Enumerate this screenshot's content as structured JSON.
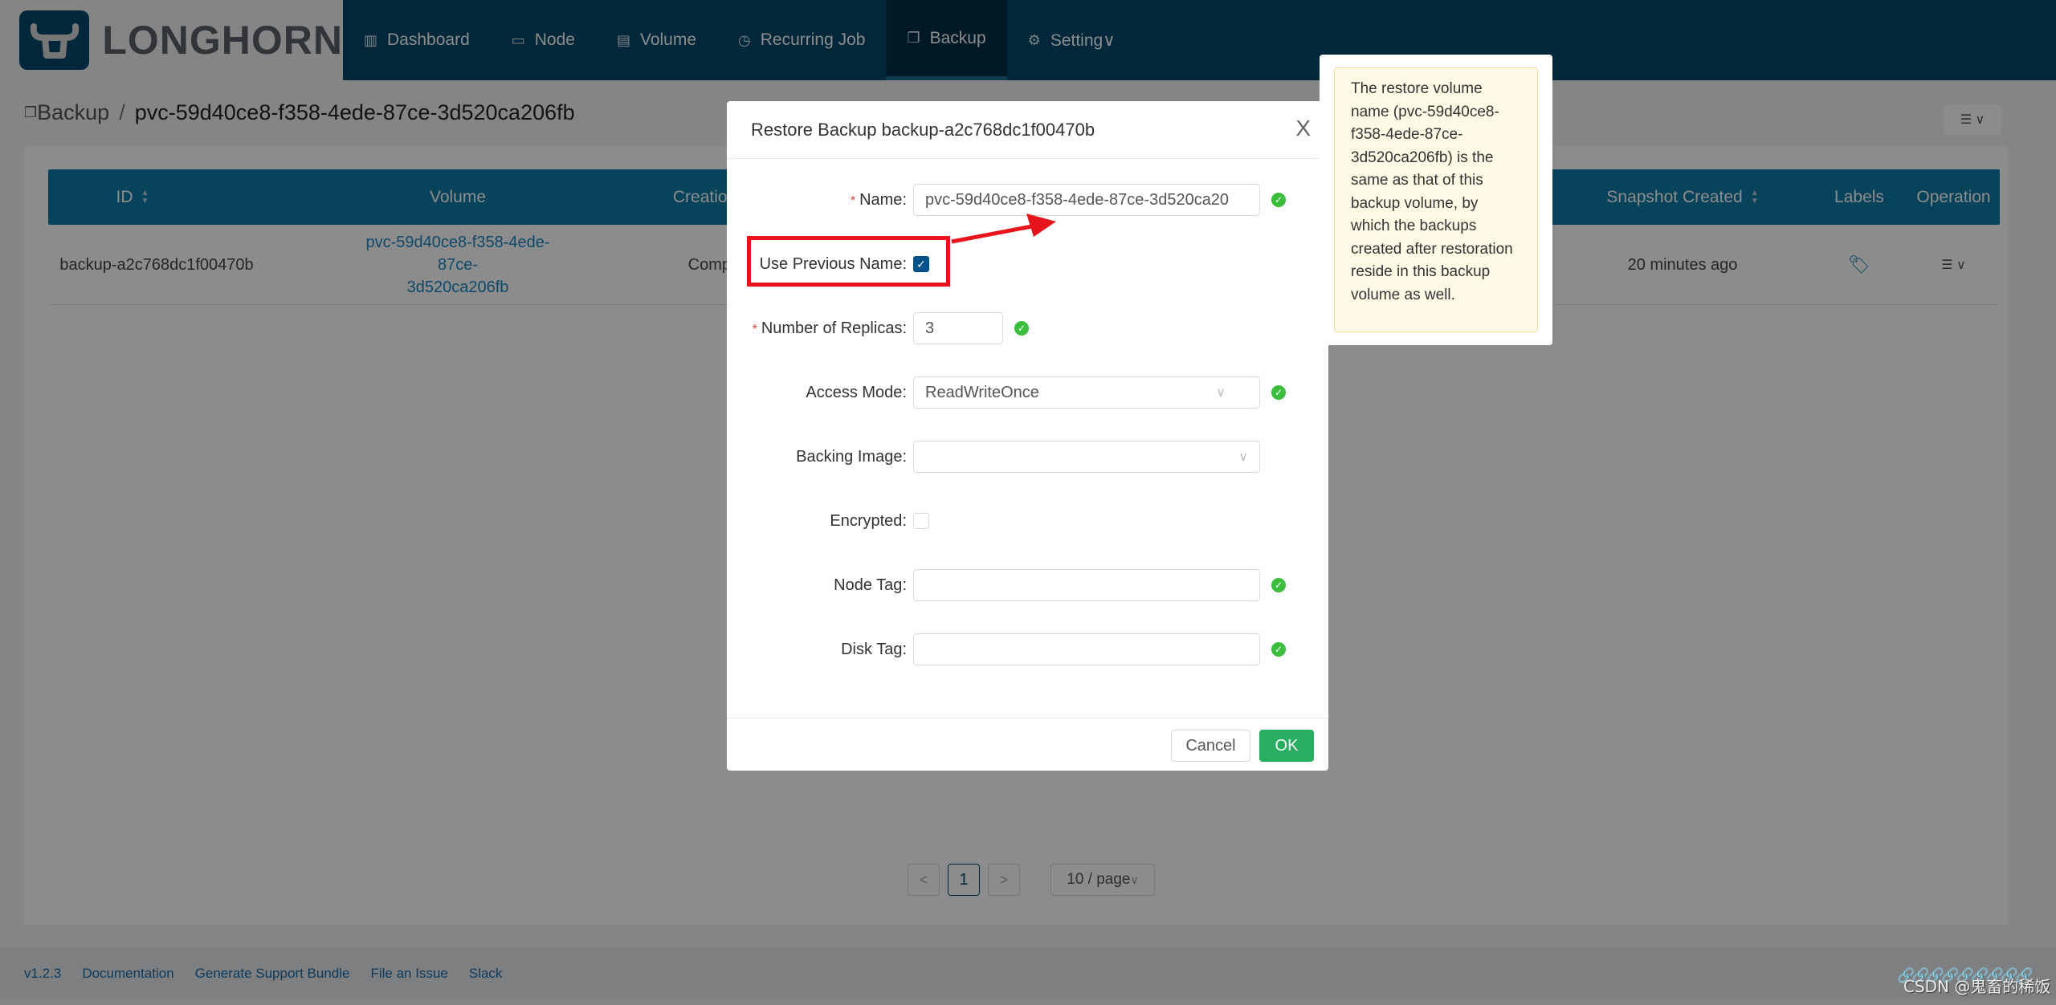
{
  "app": {
    "logo_text": "LONGHORN"
  },
  "nav": {
    "items": [
      {
        "label": "Dashboard",
        "icon": "bar-chart-icon"
      },
      {
        "label": "Node",
        "icon": "laptop-icon"
      },
      {
        "label": "Volume",
        "icon": "database-icon"
      },
      {
        "label": "Recurring Job",
        "icon": "clock-icon"
      },
      {
        "label": "Backup",
        "icon": "copy-icon",
        "active": true
      },
      {
        "label": "Setting∨",
        "icon": "gear-icon"
      }
    ]
  },
  "breadcrumb": {
    "root": "Backup",
    "separator": "/",
    "current": "pvc-59d40ce8-f358-4ede-87ce-3d520ca206fb"
  },
  "table": {
    "columns": [
      "ID",
      "Volume",
      "Creation State",
      "Snapshot Created",
      "Labels",
      "Operation"
    ],
    "rows": [
      {
        "id": "backup-a2c768dc1f00470b",
        "volume_line1": "pvc-59d40ce8-f358-4ede-87ce-",
        "volume_line2": "3d520ca206fb",
        "creation_state": "Completed",
        "snapshot_created": "20 minutes ago"
      }
    ]
  },
  "pagination": {
    "prev": "<",
    "current_page": "1",
    "next": ">",
    "page_size": "10 / page"
  },
  "footer": {
    "links": [
      "v1.2.3",
      "Documentation",
      "Generate Support Bundle",
      "File an Issue",
      "Slack"
    ]
  },
  "modal": {
    "title": "Restore Backup backup-a2c768dc1f00470b",
    "close": "X",
    "fields": {
      "name": {
        "label": "Name",
        "value": "pvc-59d40ce8-f358-4ede-87ce-3d520ca20",
        "required": true
      },
      "use_previous_name": {
        "label": "Use Previous Name",
        "checked": true
      },
      "replicas": {
        "label": "Number of Replicas",
        "value": "3",
        "required": true
      },
      "access_mode": {
        "label": "Access Mode",
        "value": "ReadWriteOnce"
      },
      "backing_image": {
        "label": "Backing Image",
        "value": ""
      },
      "encrypted": {
        "label": "Encrypted",
        "checked": false
      },
      "node_tag": {
        "label": "Node Tag",
        "value": ""
      },
      "disk_tag": {
        "label": "Disk Tag",
        "value": ""
      }
    },
    "cancel": "Cancel",
    "ok": "OK"
  },
  "popover": {
    "text": "The restore volume name (pvc-59d40ce8-f358-4ede-87ce-3d520ca206fb) is the same as that of this backup volume, by which the backups created after restoration reside in this backup volume as well."
  },
  "watermark": "CSDN @鬼畜的稀饭",
  "colors": {
    "nav_bg": "#00476b",
    "table_header": "#0e7aa6",
    "ok_button": "#27ae60",
    "annotation": "#e8141b"
  }
}
